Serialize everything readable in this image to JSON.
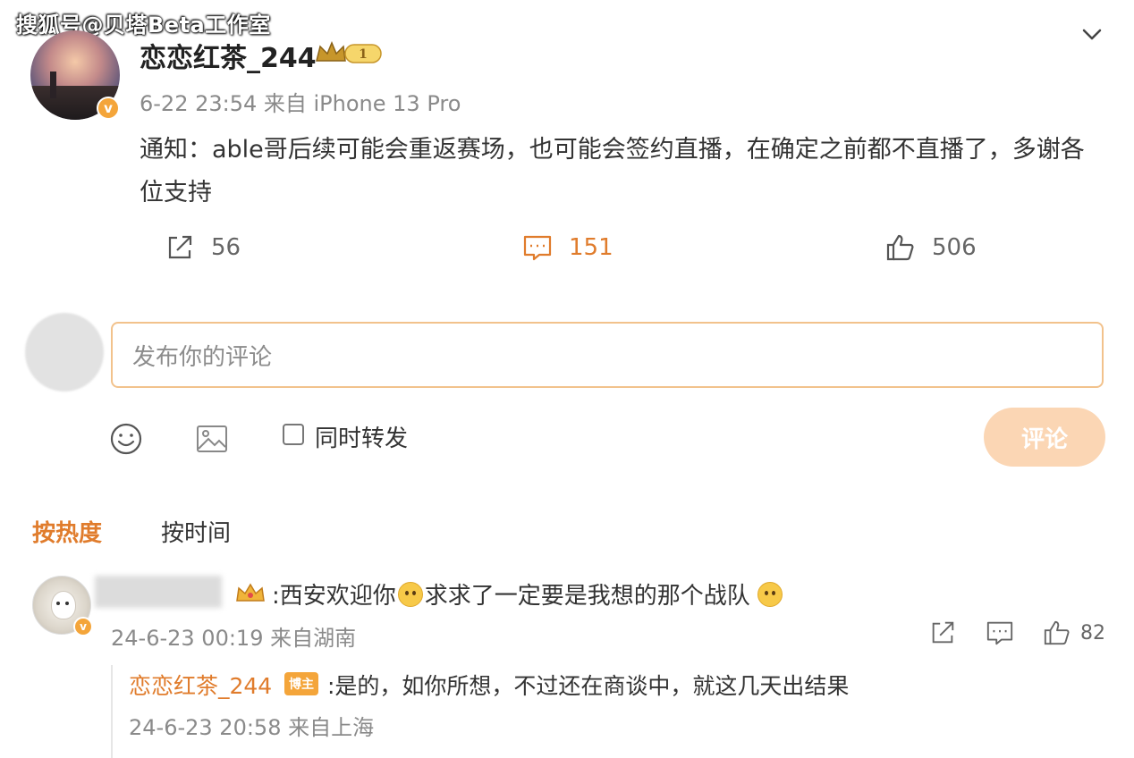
{
  "watermark": "搜狐号@贝塔Beta工作室",
  "post": {
    "username": "恋恋红茶_244",
    "level_badge": "1",
    "verified_badge": "v",
    "meta": "6-22 23:54 来自 iPhone 13 Pro",
    "text": "通知：able哥后续可能会重返赛场，也可能会签约直播，在确定之前都不直播了，多谢各位支持",
    "repost_count": "56",
    "comment_count": "151",
    "like_count": "506"
  },
  "composer": {
    "placeholder": "发布你的评论",
    "also_repost_label": "同时转发",
    "submit_label": "评论"
  },
  "sort": {
    "hot_label": "按热度",
    "time_label": "按时间"
  },
  "comments": [
    {
      "text_part1": ":西安欢迎你",
      "text_part2": "求求了一定要是我想的那个战队",
      "meta": "24-6-23 00:19 来自湖南",
      "like_count": "82",
      "verified_badge": "v",
      "reply": {
        "username": "恋恋红茶_244",
        "badge": "博主",
        "text": ":是的，如你所想，不过还在商谈中，就这几天出结果",
        "meta": "24-6-23 20:58 来自上海"
      }
    }
  ],
  "colors": {
    "accent": "#e07c2c",
    "submit_disabled": "#fbd6b4",
    "input_border": "#f2c28c",
    "badge_orange": "#f4a53a"
  },
  "icons": [
    "repost-icon",
    "comment-icon",
    "like-icon",
    "emoji-icon",
    "image-icon",
    "chevron-down-icon",
    "crown-icon"
  ]
}
